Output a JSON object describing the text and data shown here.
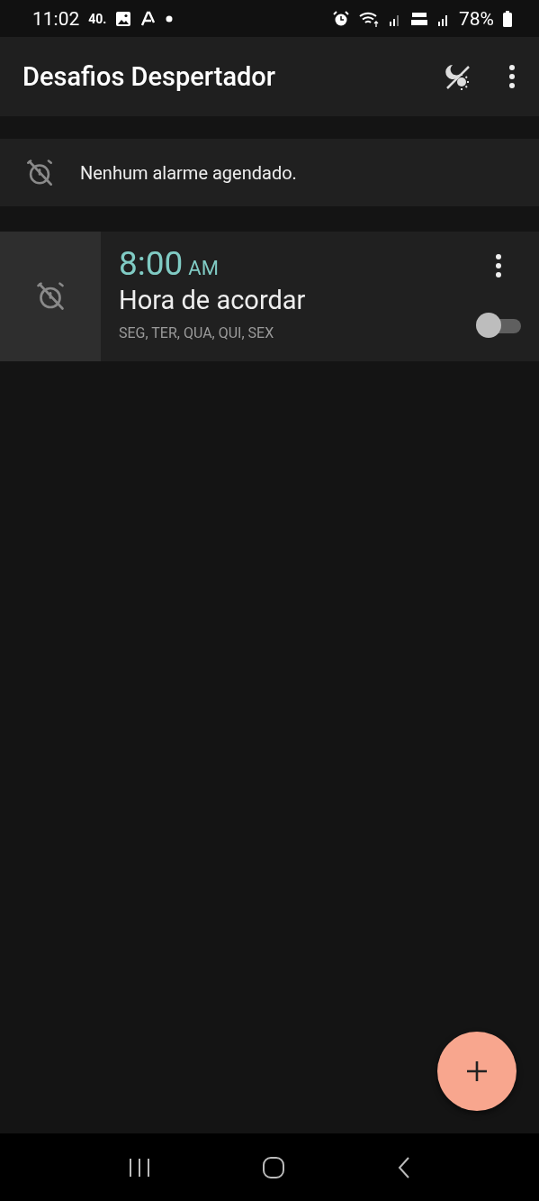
{
  "status_bar": {
    "time": "11:02",
    "notification_text": "40.",
    "battery": "78%"
  },
  "app_bar": {
    "title": "Desafios Despertador"
  },
  "banner": {
    "text": "Nenhum alarme agendado."
  },
  "alarms": [
    {
      "time": "8:00",
      "period": "AM",
      "label": "Hora de acordar",
      "days": "SEG, TER, QUA, QUI, SEX",
      "on": false
    }
  ]
}
